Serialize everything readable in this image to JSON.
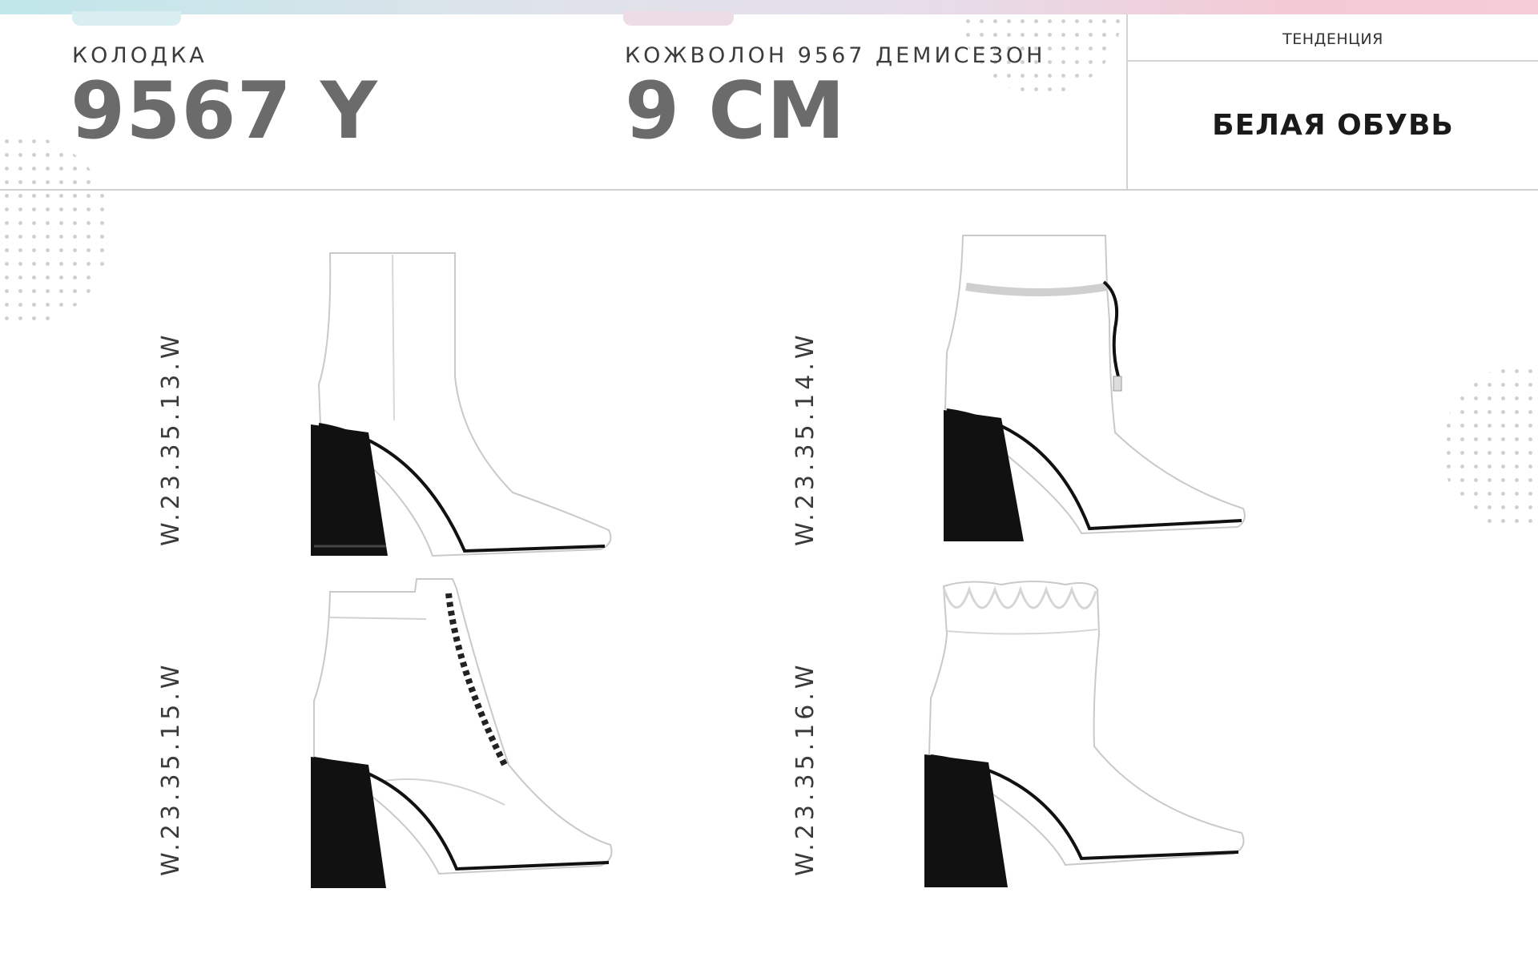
{
  "header": {
    "last_label": "КОЛОДКА",
    "last_value": "9567 Y",
    "material_label": "КОЖВОЛОН 9567 ДЕМИСЕЗОН",
    "heel_value": "9 СМ",
    "trend_label": "ТЕНДЕНЦИЯ",
    "trend_value": "БЕЛАЯ ОБУВЬ"
  },
  "products": [
    {
      "code": "W.23.35.13.W",
      "style": "classic-ankle-boot"
    },
    {
      "code": "W.23.35.14.W",
      "style": "drawstring-ankle-boot"
    },
    {
      "code": "W.23.35.15.W",
      "style": "lace-up-ankle-boot"
    },
    {
      "code": "W.23.35.16.W",
      "style": "ruffle-top-ankle-boot"
    }
  ],
  "colors": {
    "heading_gray": "#6b6b6b",
    "boot_white": "#ffffff",
    "heel_black": "#111111"
  }
}
